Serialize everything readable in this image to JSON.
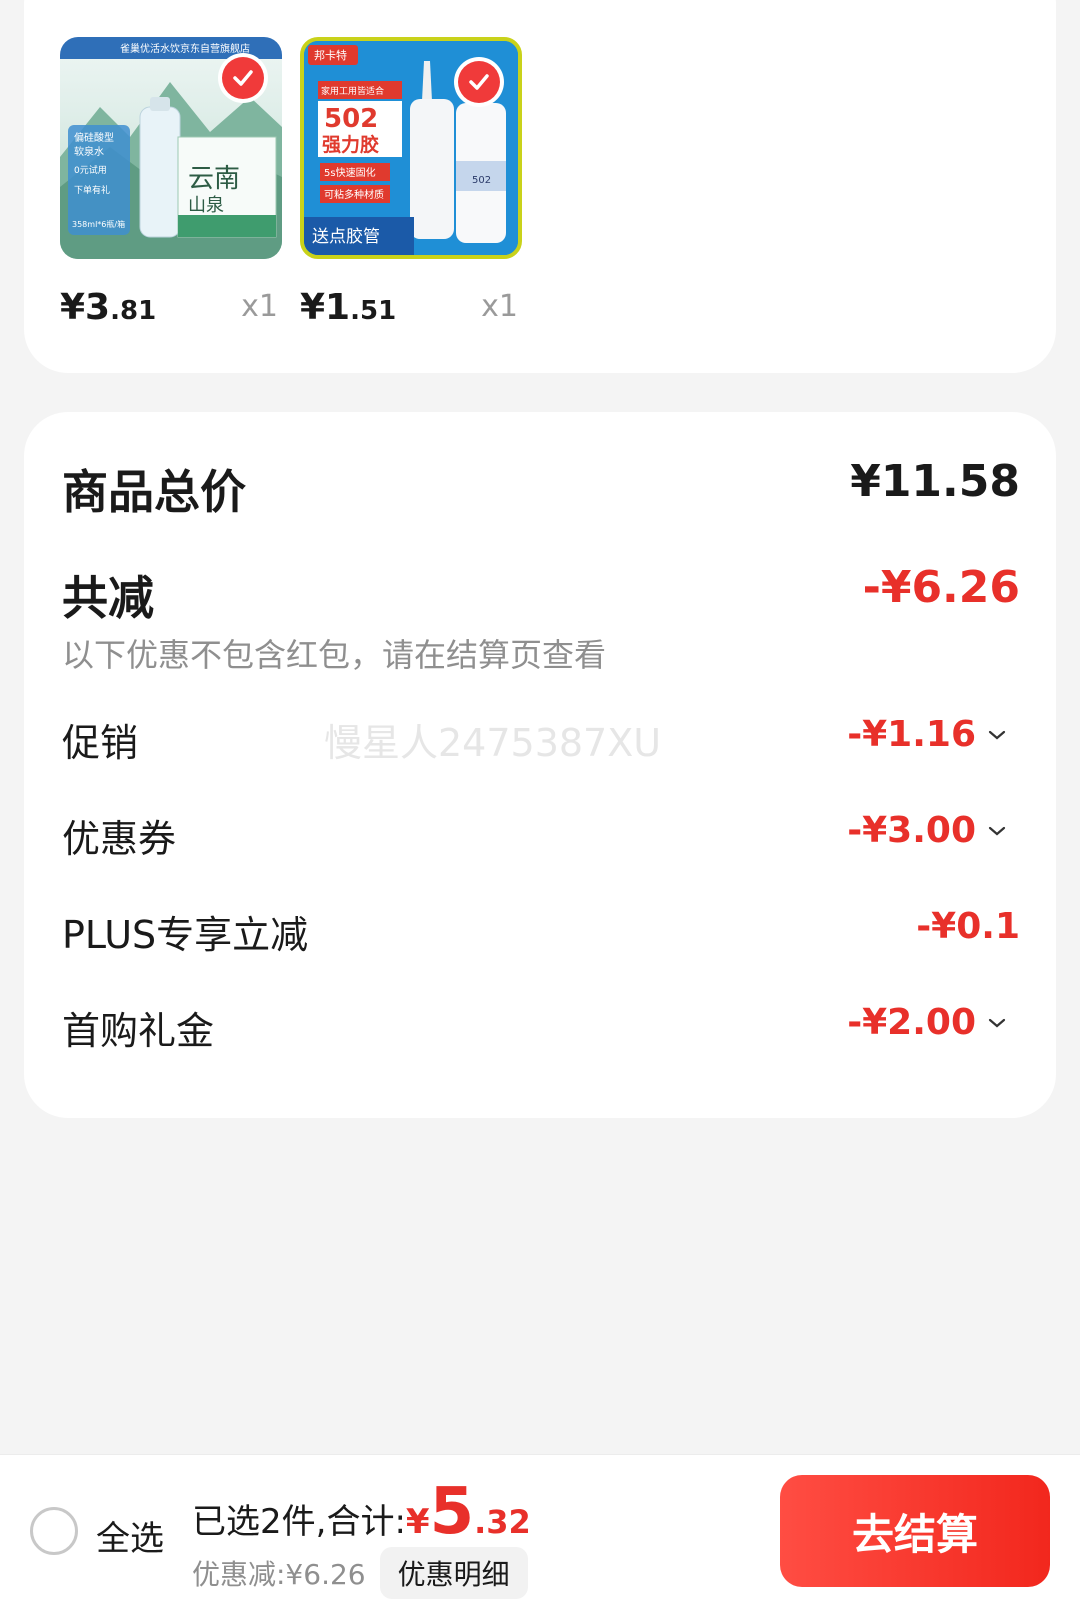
{
  "products": [
    {
      "name_on_image": "云南山泉",
      "image_texts": [
        "雀巢优活水饮京东自营旗舰店",
        "偏硅酸型软泉水",
        "0元试用",
        "下单有礼",
        "358ml*6瓶/箱"
      ],
      "price_main": "¥3",
      "price_cents": ".81",
      "qty": "x1",
      "selected": true
    },
    {
      "name_on_image": "502强力胶",
      "image_texts": [
        "邦卡特",
        "家用工用皆适合",
        "502",
        "强力胶",
        "5s快速固化",
        "可粘多种材质",
        "送点胶管"
      ],
      "price_main": "¥1",
      "price_cents": ".51",
      "qty": "x1",
      "selected": true
    }
  ],
  "summary": {
    "total_label": "商品总价",
    "total_value": "¥11.58",
    "reduce_label": "共减",
    "reduce_value": "-¥6.26",
    "hint": "以下优惠不包含红包，请在结算页查看",
    "watermark": "慢星人2475387XU",
    "rows": [
      {
        "label": "促销",
        "value": "-¥1.16",
        "expandable": true
      },
      {
        "label": "优惠券",
        "value": "-¥3.00",
        "expandable": true
      },
      {
        "label": "PLUS专享立减",
        "value": "-¥0.1",
        "expandable": false
      },
      {
        "label": "首购礼金",
        "value": "-¥2.00",
        "expandable": true
      }
    ]
  },
  "bottom": {
    "select_all": "全选",
    "selected_text": "已选2件,合计:",
    "total_yen": "¥",
    "total_int": "5",
    "total_dec": ".32",
    "discount_text": "优惠减:¥6.26",
    "detail_button": "优惠明细",
    "checkout_button": "去结算"
  },
  "colors": {
    "accent_red": "#e8302a",
    "background": "#f4f4f4",
    "card": "#ffffff"
  }
}
